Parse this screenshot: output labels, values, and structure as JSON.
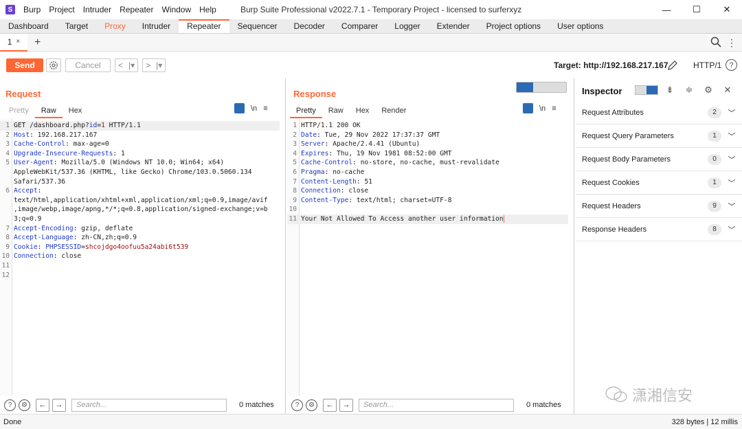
{
  "app": {
    "logo": "S",
    "title": "Burp Suite Professional v2022.7.1 - Temporary Project - licensed to surferxyz",
    "menu": [
      "Burp",
      "Project",
      "Intruder",
      "Repeater",
      "Window",
      "Help"
    ],
    "window_controls": [
      "—",
      "☐",
      "✕"
    ]
  },
  "main_tabs": [
    {
      "label": "Dashboard",
      "state": "normal"
    },
    {
      "label": "Target",
      "state": "normal"
    },
    {
      "label": "Proxy",
      "state": "orange"
    },
    {
      "label": "Intruder",
      "state": "normal"
    },
    {
      "label": "Repeater",
      "state": "active"
    },
    {
      "label": "Sequencer",
      "state": "normal"
    },
    {
      "label": "Decoder",
      "state": "normal"
    },
    {
      "label": "Comparer",
      "state": "normal"
    },
    {
      "label": "Logger",
      "state": "normal"
    },
    {
      "label": "Extender",
      "state": "normal"
    },
    {
      "label": "Project options",
      "state": "normal"
    },
    {
      "label": "User options",
      "state": "normal"
    }
  ],
  "repeater_tab": {
    "label": "1",
    "close": "×",
    "add": "+"
  },
  "toolbar": {
    "send": "Send",
    "cancel": "Cancel",
    "prev": "<",
    "prev_drop": "|▾",
    "next": ">",
    "next_drop": "|▾",
    "target": "Target: http://192.168.217.167",
    "http_version": "HTTP/1",
    "help": "?"
  },
  "request": {
    "title": "Request",
    "tabs": [
      "Pretty",
      "Raw",
      "Hex"
    ],
    "active_tab": "Raw",
    "newline_toggle": "\\n",
    "menu": "≡",
    "lines": [
      {
        "n": "1",
        "parts": [
          [
            "t",
            "GET /dashboard.php?"
          ],
          [
            "k",
            "id"
          ],
          [
            "t",
            "="
          ],
          [
            "v",
            "1"
          ],
          [
            "t",
            " HTTP/1.1"
          ]
        ]
      },
      {
        "n": "2",
        "parts": [
          [
            "k",
            "Host"
          ],
          [
            "t",
            ": 192.168.217.167"
          ]
        ]
      },
      {
        "n": "3",
        "parts": [
          [
            "k",
            "Cache-Control"
          ],
          [
            "t",
            ": max-age=0"
          ]
        ]
      },
      {
        "n": "4",
        "parts": [
          [
            "k",
            "Upgrade-Insecure-Requests"
          ],
          [
            "t",
            ": 1"
          ]
        ]
      },
      {
        "n": "5",
        "parts": [
          [
            "k",
            "User-Agent"
          ],
          [
            "t",
            ": Mozilla/5.0 (Windows NT 10.0; Win64; x64)"
          ]
        ]
      },
      {
        "n": "",
        "parts": [
          [
            "t",
            "AppleWebKit/537.36 (KHTML, like Gecko) Chrome/103.0.5060.134"
          ]
        ]
      },
      {
        "n": "",
        "parts": [
          [
            "t",
            "Safari/537.36"
          ]
        ]
      },
      {
        "n": "6",
        "parts": [
          [
            "k",
            "Accept"
          ],
          [
            "t",
            ":"
          ]
        ]
      },
      {
        "n": "",
        "parts": [
          [
            "t",
            "text/html,application/xhtml+xml,application/xml;q=0.9,image/avif"
          ]
        ]
      },
      {
        "n": "",
        "parts": [
          [
            "t",
            ",image/webp,image/apng,*/*;q=0.8,application/signed-exchange;v=b"
          ]
        ]
      },
      {
        "n": "",
        "parts": [
          [
            "t",
            "3;q=0.9"
          ]
        ]
      },
      {
        "n": "7",
        "parts": [
          [
            "k",
            "Accept-Encoding"
          ],
          [
            "t",
            ": gzip, deflate"
          ]
        ]
      },
      {
        "n": "8",
        "parts": [
          [
            "k",
            "Accept-Language"
          ],
          [
            "t",
            ": zh-CN,zh;q=0.9"
          ]
        ]
      },
      {
        "n": "9",
        "parts": [
          [
            "k",
            "Cookie"
          ],
          [
            "t",
            ": "
          ],
          [
            "k",
            "PHPSESSID"
          ],
          [
            "t",
            "="
          ],
          [
            "v",
            "shcojdgo4oofuu5a24abi6t539"
          ]
        ]
      },
      {
        "n": "10",
        "parts": [
          [
            "k",
            "Connection"
          ],
          [
            "t",
            ": close"
          ]
        ]
      },
      {
        "n": "11",
        "parts": []
      },
      {
        "n": "12",
        "parts": []
      }
    ],
    "search_placeholder": "Search...",
    "matches": "0 matches"
  },
  "response": {
    "title": "Response",
    "tabs": [
      "Pretty",
      "Raw",
      "Hex",
      "Render"
    ],
    "active_tab": "Pretty",
    "newline_toggle": "\\n",
    "menu": "≡",
    "lines": [
      {
        "n": "1",
        "parts": [
          [
            "t",
            "HTTP/1.1 200 OK"
          ]
        ]
      },
      {
        "n": "2",
        "parts": [
          [
            "k",
            "Date"
          ],
          [
            "t",
            ": Tue, 29 Nov 2022 17:37:37 GMT"
          ]
        ]
      },
      {
        "n": "3",
        "parts": [
          [
            "k",
            "Server"
          ],
          [
            "t",
            ": Apache/2.4.41 (Ubuntu)"
          ]
        ]
      },
      {
        "n": "4",
        "parts": [
          [
            "k",
            "Expires"
          ],
          [
            "t",
            ": Thu, 19 Nov 1981 08:52:00 GMT"
          ]
        ]
      },
      {
        "n": "5",
        "parts": [
          [
            "k",
            "Cache-Control"
          ],
          [
            "t",
            ": no-store, no-cache, must-revalidate"
          ]
        ]
      },
      {
        "n": "6",
        "parts": [
          [
            "k",
            "Pragma"
          ],
          [
            "t",
            ": no-cache"
          ]
        ]
      },
      {
        "n": "7",
        "parts": [
          [
            "k",
            "Content-Length"
          ],
          [
            "t",
            ": 51"
          ]
        ]
      },
      {
        "n": "8",
        "parts": [
          [
            "k",
            "Connection"
          ],
          [
            "t",
            ": close"
          ]
        ]
      },
      {
        "n": "9",
        "parts": [
          [
            "k",
            "Content-Type"
          ],
          [
            "t",
            ": text/html; charset=UTF-8"
          ]
        ]
      },
      {
        "n": "10",
        "parts": []
      },
      {
        "n": "11",
        "parts": [
          [
            "t",
            "Your Not Allowed To Access another user information"
          ]
        ]
      }
    ],
    "search_placeholder": "Search...",
    "matches": "0 matches"
  },
  "inspector": {
    "title": "Inspector",
    "sections": [
      {
        "label": "Request Attributes",
        "count": "2"
      },
      {
        "label": "Request Query Parameters",
        "count": "1"
      },
      {
        "label": "Request Body Parameters",
        "count": "0"
      },
      {
        "label": "Request Cookies",
        "count": "1"
      },
      {
        "label": "Request Headers",
        "count": "9"
      },
      {
        "label": "Response Headers",
        "count": "8"
      }
    ]
  },
  "status": {
    "left": "Done",
    "right": "328 bytes | 12 millis"
  },
  "watermark": "潇湘信安",
  "colors": {
    "accent": "#ff6633",
    "blue": "#2b6ab5",
    "key": "#1f38c6",
    "value": "#a01010"
  }
}
